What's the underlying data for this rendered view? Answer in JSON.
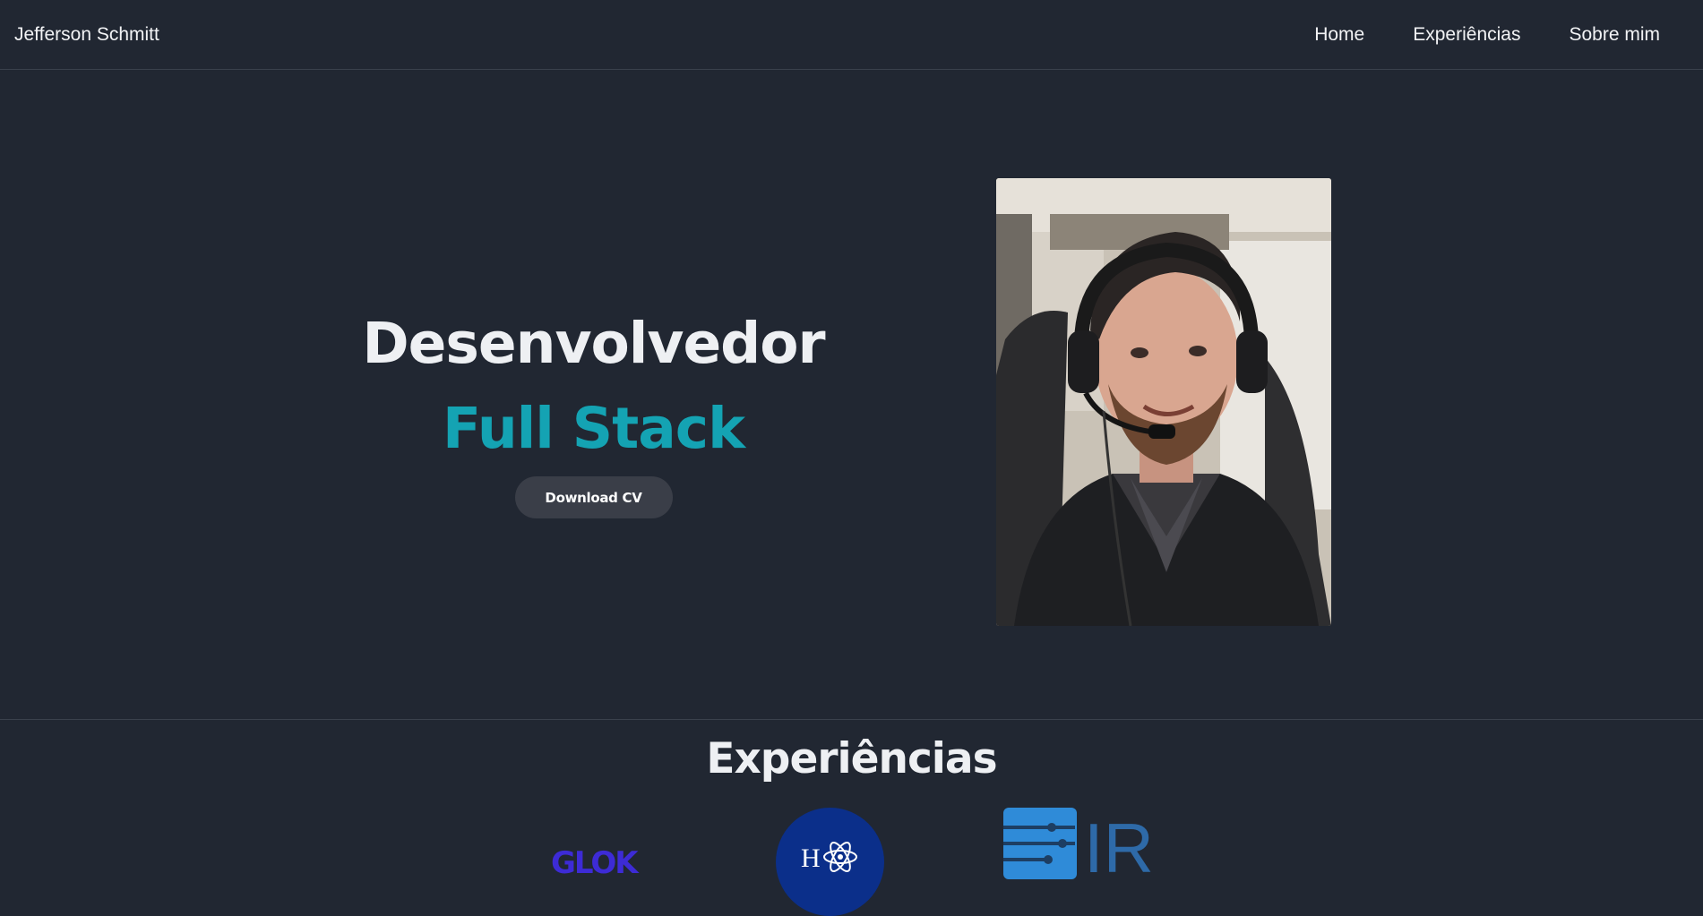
{
  "navbar": {
    "brand": "Jefferson Schmitt",
    "links": [
      "Home",
      "Experiências",
      "Sobre mim"
    ]
  },
  "hero": {
    "title": "Desenvolvedor",
    "subtitle": "Full Stack",
    "download_label": "Download CV",
    "photo_name": "profile-photo"
  },
  "experiences": {
    "title": "Experiências",
    "logos": [
      {
        "name": "glok-logo",
        "text": "GLOK"
      },
      {
        "name": "h-science-logo",
        "text": "H"
      },
      {
        "name": "ir-logo",
        "text": "IR"
      }
    ]
  },
  "colors": {
    "background": "#212732",
    "accent": "#14a3b3",
    "button": "#3a3e48",
    "text": "#eef0f3"
  }
}
